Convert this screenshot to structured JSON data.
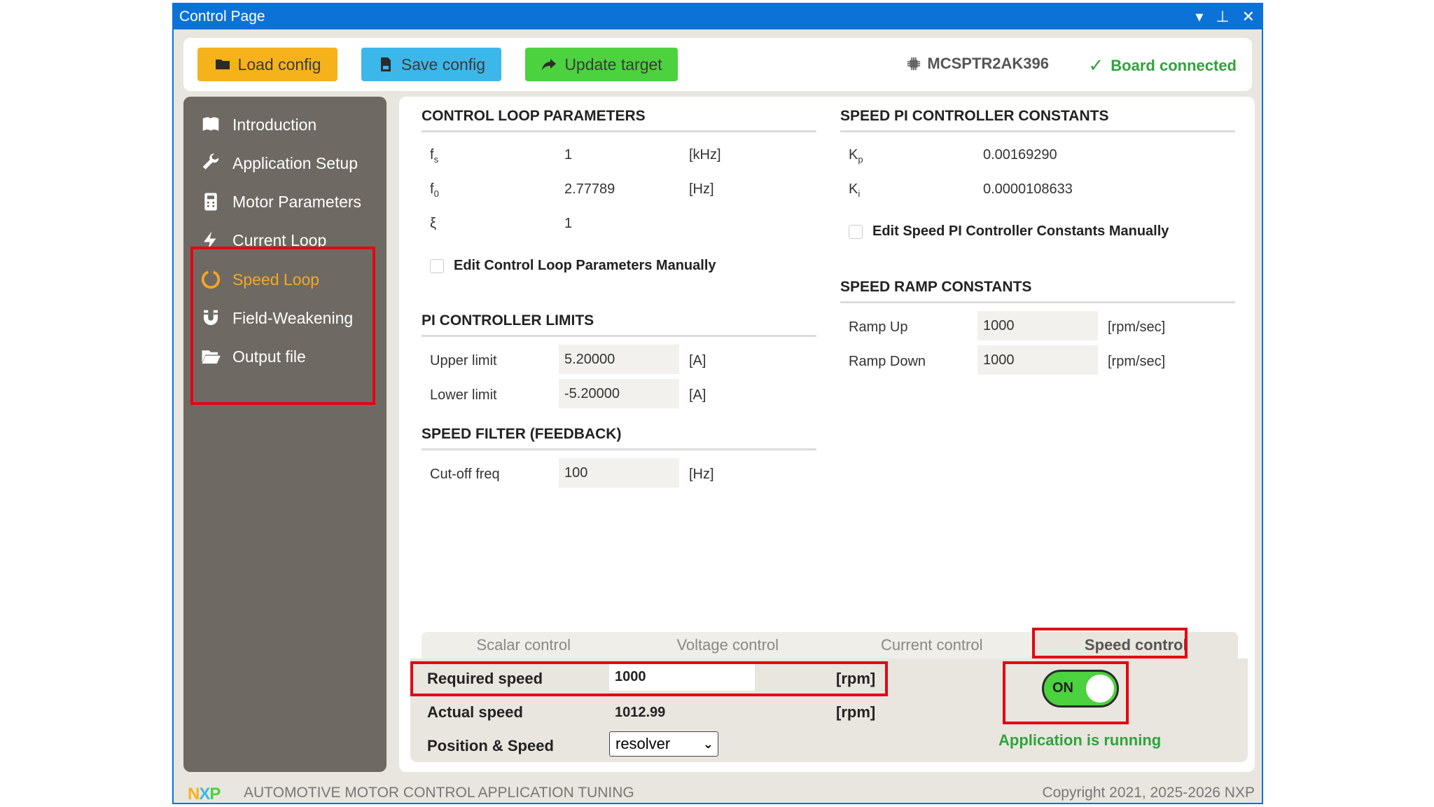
{
  "window": {
    "title": "Control Page"
  },
  "toolbar": {
    "load_label": "Load config",
    "save_label": "Save config",
    "update_label": "Update target",
    "board_id": "MCSPTR2AK396",
    "board_status": "Board connected"
  },
  "sidebar": {
    "items": [
      {
        "label": "Introduction"
      },
      {
        "label": "Application Setup"
      },
      {
        "label": "Motor Parameters"
      },
      {
        "label": "Current Loop"
      },
      {
        "label": "Speed Loop"
      },
      {
        "label": "Field-Weakening"
      },
      {
        "label": "Output file"
      }
    ]
  },
  "control_loop": {
    "title": "CONTROL LOOP PARAMETERS",
    "rows": [
      {
        "symbol": "f",
        "sub": "s",
        "value": "1",
        "unit": "[kHz]"
      },
      {
        "symbol": "f",
        "sub": "0",
        "value": "2.77789",
        "unit": "[Hz]"
      },
      {
        "symbol": "ξ",
        "sub": "",
        "value": "1",
        "unit": ""
      }
    ],
    "manual_label": "Edit Control Loop Parameters Manually"
  },
  "pi_limits": {
    "title": "PI CONTROLLER LIMITS",
    "upper_label": "Upper limit",
    "upper_value": "5.20000",
    "upper_unit": "[A]",
    "lower_label": "Lower limit",
    "lower_value": "-5.20000",
    "lower_unit": "[A]"
  },
  "speed_filter": {
    "title": "SPEED FILTER (FEEDBACK)",
    "cutoff_label": "Cut-off freq",
    "cutoff_value": "100",
    "cutoff_unit": "[Hz]"
  },
  "speed_pi": {
    "title": "SPEED PI CONTROLLER CONSTANTS",
    "kp_symbol": "K",
    "kp_sub": "p",
    "kp_value": "0.00169290",
    "ki_symbol": "K",
    "ki_sub": "i",
    "ki_value": "0.0000108633",
    "manual_label": "Edit Speed PI Controller Constants Manually"
  },
  "ramp": {
    "title": "SPEED RAMP CONSTANTS",
    "up_label": "Ramp Up",
    "up_value": "1000",
    "up_unit": "[rpm/sec]",
    "down_label": "Ramp Down",
    "down_value": "1000",
    "down_unit": "[rpm/sec]"
  },
  "tabs": [
    "Scalar control",
    "Voltage control",
    "Current control",
    "Speed control"
  ],
  "speed_panel": {
    "required_label": "Required speed",
    "required_value": "1000",
    "required_unit": "[rpm]",
    "actual_label": "Actual speed",
    "actual_value": "1012.99",
    "actual_unit": "[rpm]",
    "position_label": "Position & Speed",
    "position_selected": "resolver",
    "toggle_label": "ON",
    "status": "Application is running"
  },
  "footer": {
    "logo": "NXP",
    "app_name": "AUTOMOTIVE MOTOR CONTROL APPLICATION TUNING",
    "copyright": "Copyright 2021, 2025-2026 NXP"
  },
  "colors": {
    "accent": "#0c72d8",
    "load": "#f5b21b",
    "save": "#3cb7ea",
    "update": "#4cd13f",
    "active_nav": "#f5a623",
    "success": "#2ea43b",
    "highlight": "#e30613"
  }
}
